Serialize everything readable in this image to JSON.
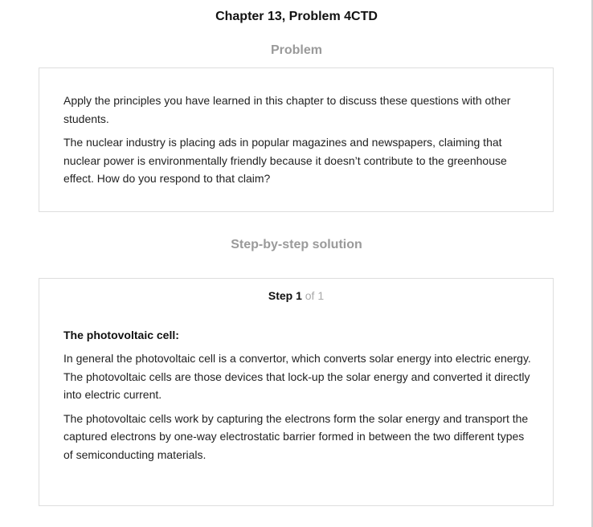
{
  "header": {
    "title": "Chapter 13, Problem 4CTD"
  },
  "problem": {
    "heading": "Problem",
    "paragraphs": [
      "Apply the principles you have learned in this chapter to discuss these questions with other students.",
      "The nuclear industry is placing ads in popular magazines and newspapers, claiming that nuclear power is environmentally friendly because it doesn’t contribute to the greenhouse effect. How do you respond to that claim?"
    ]
  },
  "solution": {
    "heading": "Step-by-step solution",
    "step_label": "Step 1",
    "step_count": "of 1",
    "subheading": "The photovoltaic cell:",
    "paragraphs": [
      "In general the photovoltaic cell is a convertor, which converts solar energy into electric energy. The photovoltaic cells are those devices that lock-up the solar energy and converted it directly into electric current.",
      "The photovoltaic cells work by capturing the electrons form the solar energy and transport the captured electrons by one-way electrostatic barrier formed in between the two different types of semiconducting materials."
    ]
  }
}
